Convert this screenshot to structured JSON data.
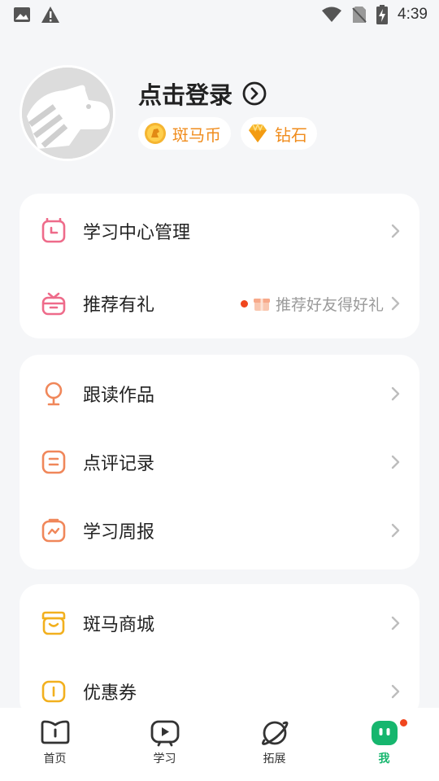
{
  "status_bar": {
    "time": "4:39",
    "left_icons": [
      "image-icon",
      "alert-icon"
    ],
    "right_icons": [
      "wifi-icon",
      "no-sim-icon",
      "battery-charging-icon"
    ]
  },
  "profile": {
    "login_label": "点击登录",
    "badges": [
      {
        "label": "斑马币",
        "icon": "zebra-coin-icon"
      },
      {
        "label": "钻石",
        "icon": "diamond-icon"
      }
    ]
  },
  "cards": [
    {
      "rows": [
        {
          "label": "学习中心管理",
          "icon": "calendar-clock-icon",
          "color": "#ee6b8a"
        },
        {
          "label": "推荐有礼",
          "icon": "gift-icon",
          "color": "#ee6b8a",
          "hint": "推荐好友得好礼"
        }
      ]
    },
    {
      "rows": [
        {
          "label": "跟读作品",
          "icon": "microphone-icon",
          "color": "#f0875a"
        },
        {
          "label": "点评记录",
          "icon": "comment-icon",
          "color": "#f0875a"
        },
        {
          "label": "学习周报",
          "icon": "report-icon",
          "color": "#f0875a"
        }
      ]
    },
    {
      "rows": [
        {
          "label": "斑马商城",
          "icon": "shop-icon",
          "color": "#f2b01e"
        },
        {
          "label": "优惠券",
          "icon": "coupon-icon",
          "color": "#f2b01e"
        }
      ]
    }
  ],
  "tabbar": {
    "tabs": [
      {
        "label": "首页",
        "icon": "book-icon",
        "active": false
      },
      {
        "label": "学习",
        "icon": "tv-icon",
        "active": false
      },
      {
        "label": "拓展",
        "icon": "planet-icon",
        "active": false
      },
      {
        "label": "我",
        "icon": "profile-face-icon",
        "active": true
      }
    ],
    "active_color": "#16b66e"
  }
}
